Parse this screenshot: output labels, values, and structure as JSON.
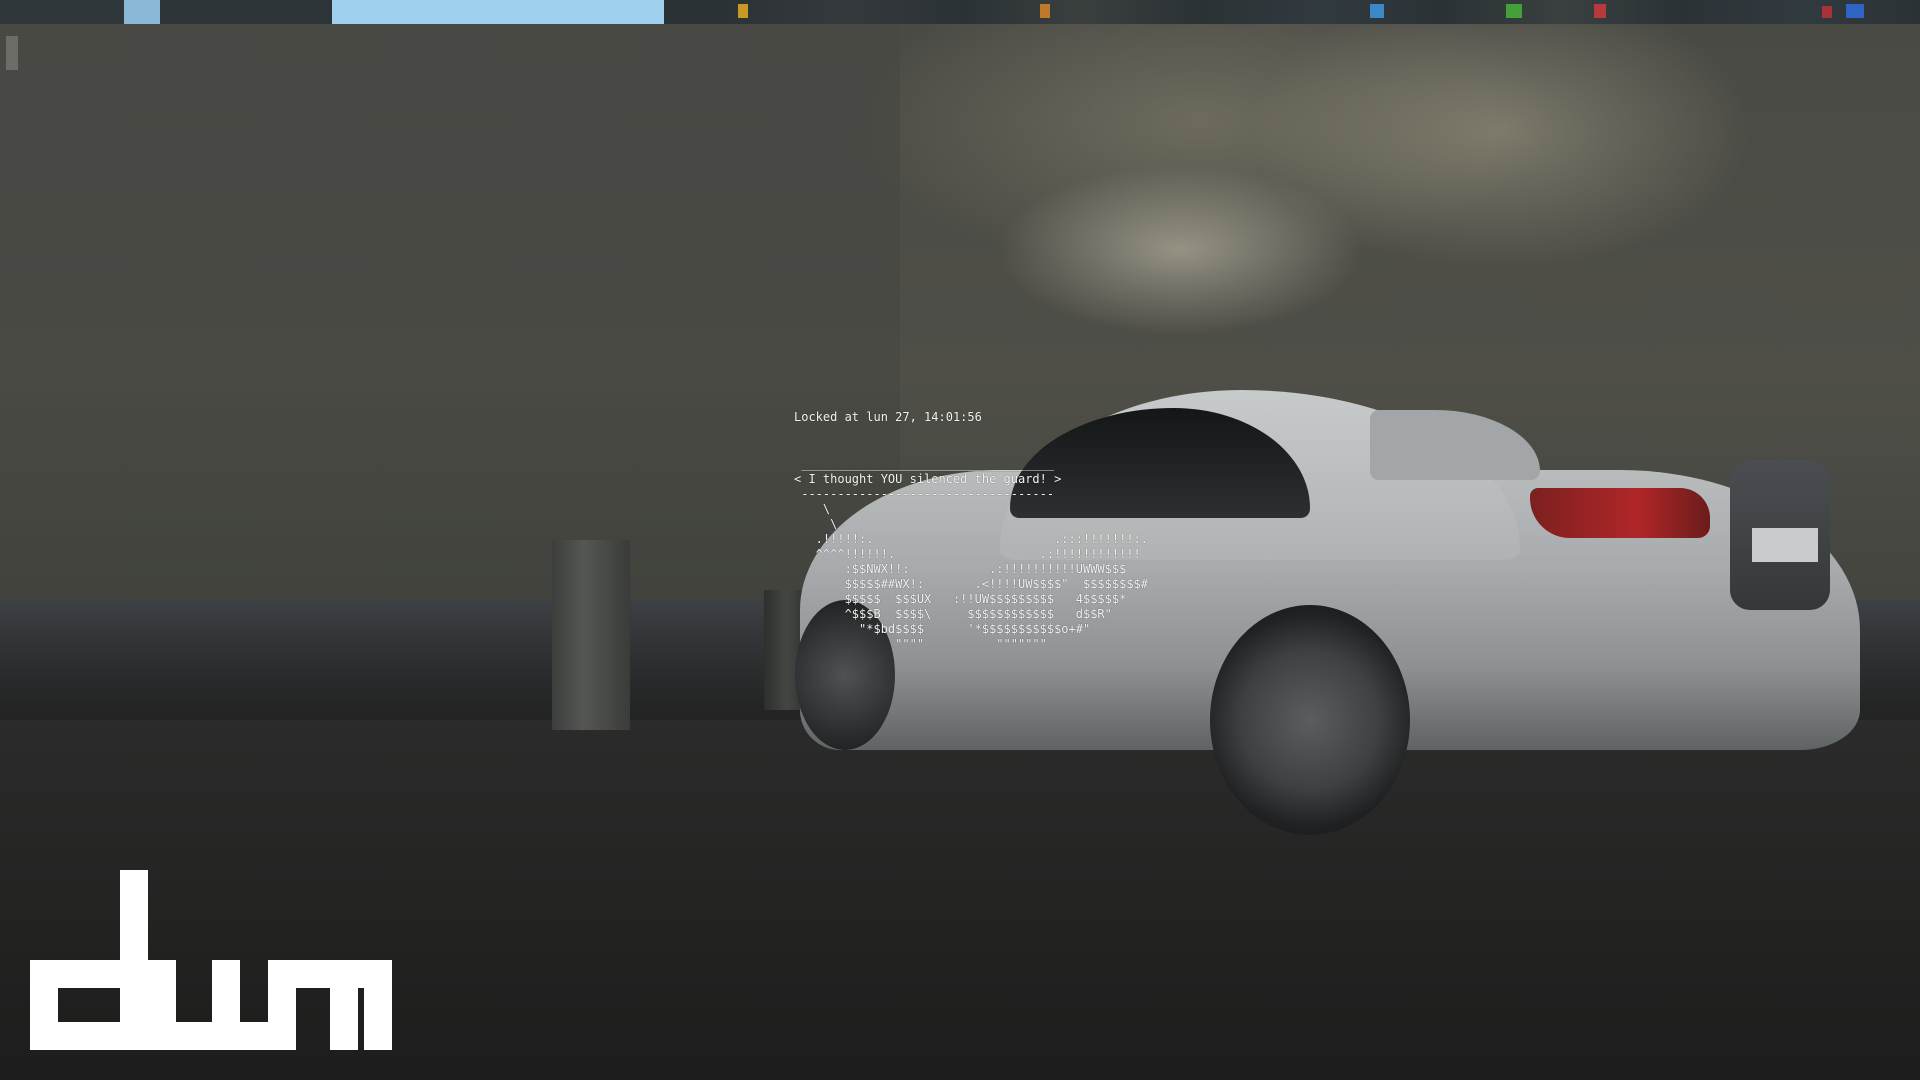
{
  "lockscreen": {
    "locked_at": "Locked at lun 27, 14:01:56",
    "cowsay_lines": [
      " ___________________________________",
      "< I thought YOU silenced the guard! >",
      " -----------------------------------",
      "    \\",
      "     \\",
      "   .!!!!!:.                         .:::!!!!!!!:.",
      "   ^^^^!!!!!!.                    .:!!!!!!!!!!!!",
      "       :$$NWX!!:           .:!!!!!!!!!!UWWW$$$",
      "       $$$$$##WX!:       .<!!!!UW$$$$\"  $$$$$$$$#",
      "       $$$$$  $$$UX   :!!UW$$$$$$$$$   4$$$$$*",
      "       ^$$$B  $$$$\\     $$$$$$$$$$$$   d$$R\"",
      "         \"*$bd$$$$      '*$$$$$$$$$$$o+#\"",
      "              \"\"\"\"          \"\"\"\"\"\"\""
    ]
  },
  "branding": {
    "logo_text": "dwm"
  },
  "colors": {
    "statusbar_bg": "#2b3236",
    "statusbar_highlight": "#9fd0ee",
    "lock_text": "#f2f2f0",
    "logo_fill": "#ffffff"
  },
  "statusbar": {
    "icons": [
      "tag-icon",
      "window-title-icon",
      "status-icon"
    ]
  }
}
